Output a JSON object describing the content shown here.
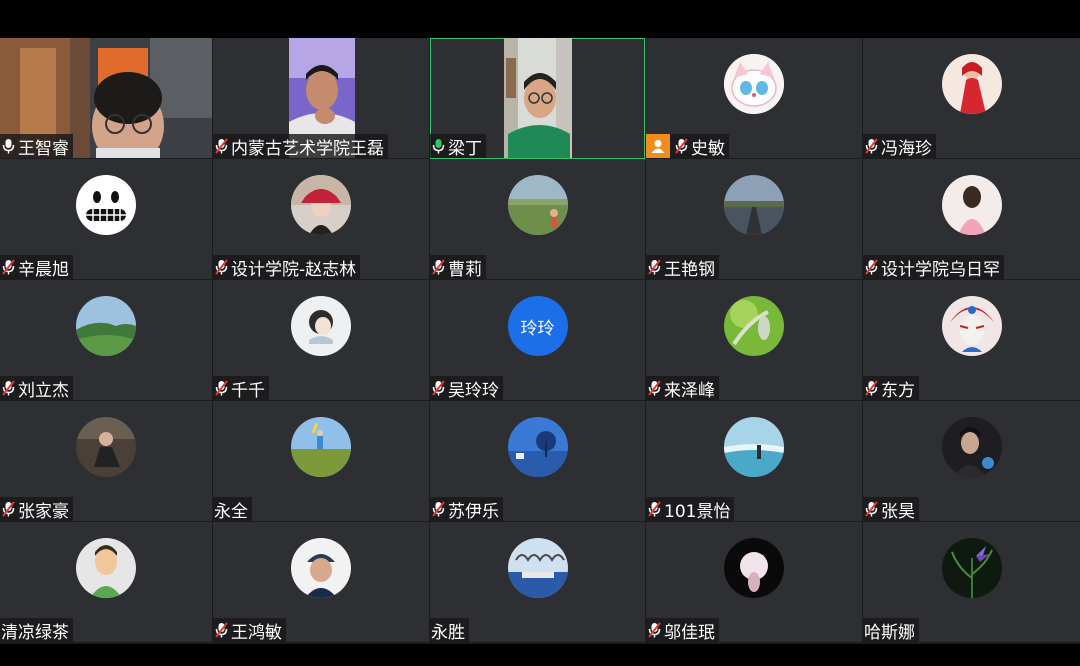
{
  "participants": [
    {
      "name": "王智睿",
      "mic": "on",
      "video": true,
      "active": false
    },
    {
      "name": "内蒙古艺术学院王磊",
      "mic": "muted",
      "video": true,
      "active": false
    },
    {
      "name": "梁丁",
      "mic": "on-green",
      "video": true,
      "active": true
    },
    {
      "name": "史敏",
      "mic": "muted",
      "video": false,
      "host": true
    },
    {
      "name": "冯海珍",
      "mic": "muted",
      "video": false
    },
    {
      "name": "辛晨旭",
      "mic": "muted",
      "video": false
    },
    {
      "name": "设计学院-赵志林",
      "mic": "muted",
      "video": false
    },
    {
      "name": "曹莉",
      "mic": "muted",
      "video": false
    },
    {
      "name": "王艳钢",
      "mic": "muted",
      "video": false
    },
    {
      "name": "设计学院乌日罕",
      "mic": "muted",
      "video": false
    },
    {
      "name": "刘立杰",
      "mic": "muted",
      "video": false
    },
    {
      "name": "千千",
      "mic": "muted",
      "video": false
    },
    {
      "name": "吴玲玲",
      "mic": "muted",
      "video": false,
      "avatar_text": "玲玲"
    },
    {
      "name": "来泽峰",
      "mic": "muted",
      "video": false
    },
    {
      "name": "东方",
      "mic": "muted",
      "video": false
    },
    {
      "name": "张家豪",
      "mic": "muted",
      "video": false
    },
    {
      "name": "永全",
      "mic": "none",
      "video": false
    },
    {
      "name": "苏伊乐",
      "mic": "muted",
      "video": false
    },
    {
      "name": "101景怡",
      "mic": "muted",
      "video": false
    },
    {
      "name": "张昊",
      "mic": "muted",
      "video": false
    },
    {
      "name": "清凉绿茶",
      "mic": "none",
      "video": false
    },
    {
      "name": "王鸿敏",
      "mic": "muted",
      "video": false
    },
    {
      "name": "永胜",
      "mic": "none",
      "video": false
    },
    {
      "name": "邬佳珉",
      "mic": "muted",
      "video": false
    },
    {
      "name": "哈斯娜",
      "mic": "none",
      "video": false
    }
  ],
  "colors": {
    "active_border": "#36c36b",
    "host_badge": "#f28c1f",
    "tile_bg": "#2d2f32"
  }
}
